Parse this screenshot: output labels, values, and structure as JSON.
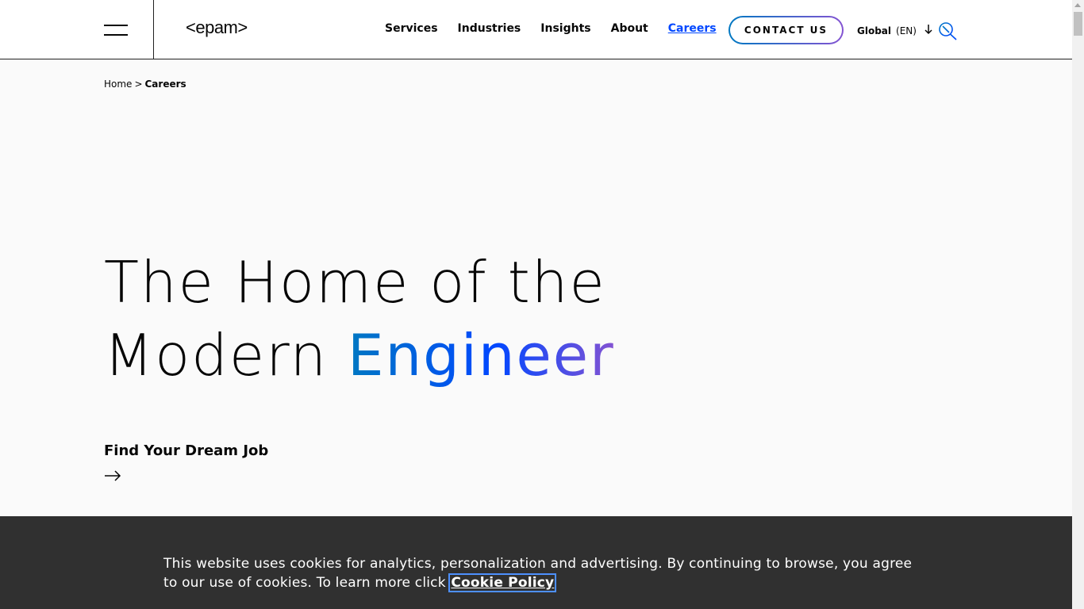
{
  "header": {
    "logo_text": "<epam>",
    "nav": [
      {
        "label": "Services"
      },
      {
        "label": "Industries"
      },
      {
        "label": "Insights"
      },
      {
        "label": "About"
      },
      {
        "label": "Careers",
        "active": true
      }
    ],
    "contact_label": "CONTACT US",
    "language": {
      "region": "Global",
      "code": "(EN)"
    },
    "icons": {
      "menu": "hamburger-menu-icon",
      "language_arrow": "arrow-down-icon",
      "search": "search-icon"
    }
  },
  "breadcrumb": {
    "home": "Home",
    "separator": ">",
    "current": "Careers"
  },
  "hero": {
    "line1": "The Home of the",
    "line2_prefix": "Modern ",
    "line2_accent": "Engineer"
  },
  "cta": {
    "label": "Find Your Dream Job",
    "icon": "arrow-right-icon"
  },
  "cookie_banner": {
    "text": "This website uses cookies for analytics, personalization and advertising. By continuing to browse, you agree to our use of cookies. To learn more click ",
    "link_label": "Cookie Policy"
  },
  "colors": {
    "accent_blue": "#0047ff",
    "gradient_start": "#0078c2",
    "gradient_end": "#8453d2",
    "banner_bg": "#303030"
  }
}
